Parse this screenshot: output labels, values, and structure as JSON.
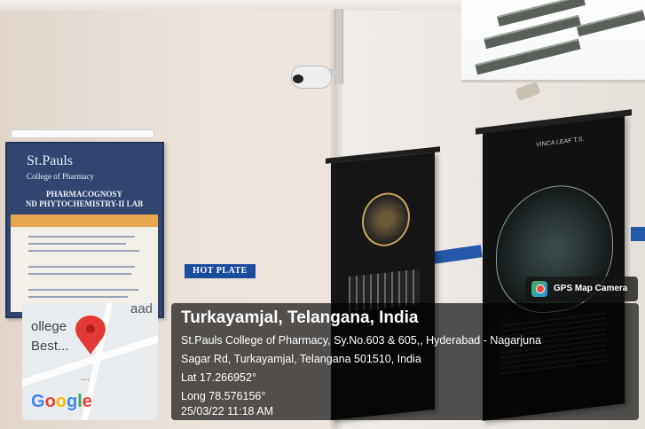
{
  "photo": {
    "board": {
      "logo_name": "St.Pauls",
      "logo_sub": "College of Pharmacy",
      "title_line1": "PHARMACOGNOSY",
      "title_line2": "ND PHYTOCHEMISTRY-II LAB"
    },
    "hot_plate_sign": "HOT PLATE",
    "chart_right_title": "VINCA LEAF T.S."
  },
  "gps_badge": {
    "label": "GPS Map Camera",
    "icon": "gps-map-camera-icon"
  },
  "map": {
    "label_1": "ollege",
    "label_2": "Best...",
    "label_3": "aad",
    "dots": "...",
    "pin_color": "#e53935",
    "brand": [
      "G",
      "o",
      "o",
      "g",
      "l",
      "e"
    ]
  },
  "location": {
    "title": "Turkayamjal, Telangana, India",
    "address_line1": "St.Pauls College of Pharmacy, Sy.No.603 & 605,, Hyderabad - Nagarjuna",
    "address_line2": "Sagar Rd, Turkayamjal, Telangana 501510, India",
    "lat": "Lat 17.266952°",
    "long": "Long 78.576156°",
    "datetime": "25/03/22 11:18 AM"
  }
}
